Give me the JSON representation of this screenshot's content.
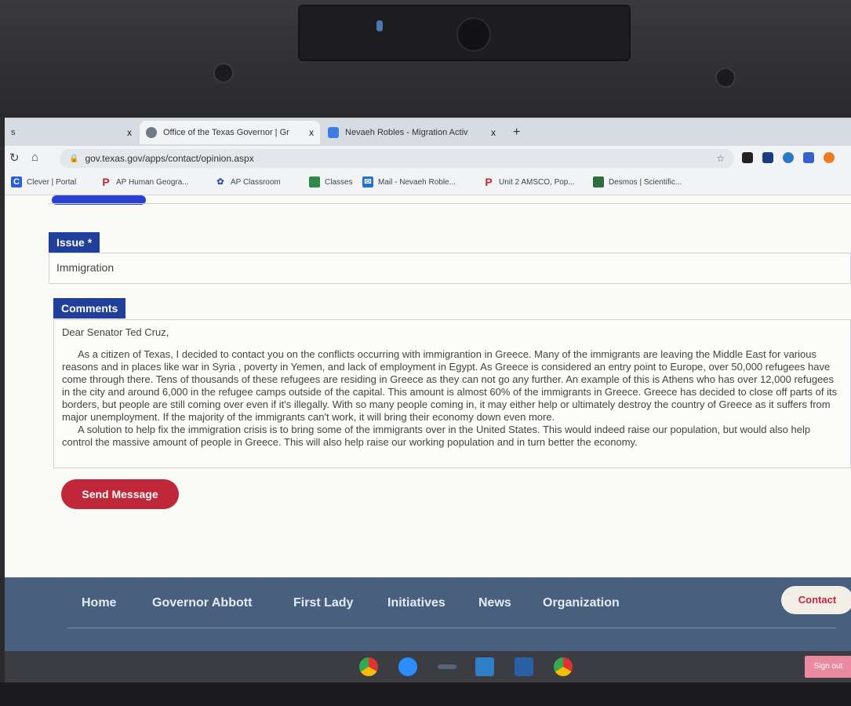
{
  "browser": {
    "tabs": [
      {
        "label": "s",
        "active": false
      },
      {
        "label": "Office of the Texas Governor | Gr",
        "active": true
      },
      {
        "label": "Nevaeh Robles - Migration Activ",
        "active": false
      }
    ],
    "tab_close": "x",
    "new_tab": "+",
    "url": "gov.texas.gov/apps/contact/opinion.aspx",
    "bookmarks": [
      "Clever | Portal",
      "AP Human Geogra...",
      "AP Classroom",
      "Classes",
      "Mail - Nevaeh Roble...",
      "Unit 2 AMSCO, Pop...",
      "Desmos | Scientific..."
    ]
  },
  "form": {
    "issue_label": "Issue *",
    "issue_value": "Immigration",
    "comments_label": "Comments",
    "comments_lines": [
      "Dear Senator Ted Cruz,",
      "As a citizen of Texas, I decided to contact you on the conflicts occurring with immigrantion in Greece. Many of the immigrants are leaving the Middle East for various reasons and in places like war in Syria , poverty in Yemen, and lack of employment in Egypt. As Greece is considered an entry point to Europe, over 50,000 refugees have come through there. Tens of thousands of these refugees are residing in Greece as they can not go any further. An example of this is Athens who has over 12,000 refugees in the city and around 6,000 in the refugee camps outside of the capital. This amount is almost 60% of the immigrants in Greece. Greece has decided to close off parts of its borders, but people are still coming over even if it's illegally. With so many people coming in, it may either help or ultimately destroy the country of Greece as it suffers from major unemployment. If the majority of the immigrants can't work, it will bring their economy down even more.",
      "A solution to help fix the immigration crisis is to bring some of the immigrants over in the United States. This would indeed raise our population, but would also help control the massive amount of people in Greece. This will also help raise our working population and in turn better the economy."
    ],
    "send_label": "Send Message"
  },
  "footer": {
    "nav": [
      "Home",
      "Governor Abbott",
      "First Lady",
      "Initiatives",
      "News",
      "Organization"
    ],
    "contact_label": "Contact"
  },
  "shelf": {
    "sign_out": "Sign out"
  },
  "colors": {
    "label_blue": "#1f3f9a",
    "send_red": "#c0283a",
    "footer_slate": "#485f7e"
  }
}
